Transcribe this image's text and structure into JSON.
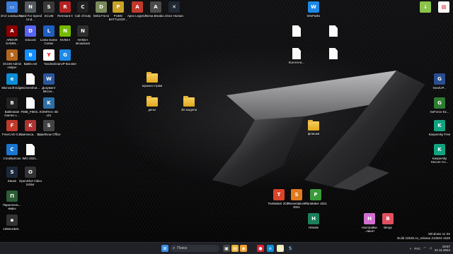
{
  "desktop": {
    "icons": [
      {
        "id": "this-pc",
        "label": "Этот компьютер",
        "kind": "app",
        "color": "#3b7dd8",
        "glyph": "▭"
      },
      {
        "id": "nfs",
        "label": "Need For Speed Und...",
        "kind": "app",
        "color": "#555a60",
        "glyph": "N"
      },
      {
        "id": "scum",
        "label": "SCUM",
        "kind": "app",
        "color": "#3a3a3a",
        "glyph": "S"
      },
      {
        "id": "remnant",
        "label": "Remnant II",
        "kind": "app",
        "color": "#b22222",
        "glyph": "R"
      },
      {
        "id": "cod",
        "label": "Call of Duty",
        "kind": "app",
        "color": "#222",
        "glyph": "C"
      },
      {
        "id": "delta",
        "label": "Delta Force",
        "kind": "app",
        "color": "#7a8a5a",
        "glyph": "D"
      },
      {
        "id": "pubg",
        "label": "PUBG BATTLEGR...",
        "kind": "app",
        "color": "#c9a227",
        "glyph": "P"
      },
      {
        "id": "apex",
        "label": "Apex Legends",
        "kind": "app",
        "color": "#c0392b",
        "glyph": "A"
      },
      {
        "id": "arena",
        "label": "Arena Breako...",
        "kind": "app",
        "color": "#4a4a4a",
        "glyph": "A"
      },
      {
        "id": "once-human",
        "label": "Once Human",
        "kind": "app",
        "color": "#202833",
        "glyph": "✕"
      },
      {
        "id": "ardor",
        "label": "ARDOR GAMIN...",
        "kind": "app",
        "color": "#8b0000",
        "glyph": "A"
      },
      {
        "id": "discord",
        "label": "Discord",
        "kind": "app",
        "color": "#5865f2",
        "glyph": "D"
      },
      {
        "id": "lesta",
        "label": "Lesta Game Center",
        "kind": "app",
        "color": "#1f5fbf",
        "glyph": "L"
      },
      {
        "id": "nvidia",
        "label": "NVIDIA",
        "kind": "app",
        "color": "#76b900",
        "glyph": "N"
      },
      {
        "id": "nvidia-broadcast",
        "label": "NVIDIA Broadcast",
        "kind": "app",
        "color": "#2e2e2e",
        "glyph": "N"
      },
      {
        "id": "scum-admin",
        "label": "SCUM Admin Helper",
        "kind": "app",
        "color": "#b5651d",
        "glyph": "S"
      },
      {
        "id": "battlenet",
        "label": "Battle.net",
        "kind": "app",
        "color": "#148eff",
        "glyph": "B"
      },
      {
        "id": "yandex",
        "label": "Yandex",
        "kind": "app",
        "color": "#ffffff",
        "glyph": "Y"
      },
      {
        "id": "gearup",
        "label": "GearUP Booster",
        "kind": "app",
        "color": "#1e88e5",
        "glyph": "G"
      },
      {
        "id": "edge",
        "label": "Microsoft Edge",
        "kind": "app",
        "color": "#0c8dd6",
        "glyph": "e"
      },
      {
        "id": "screenshot",
        "label": "Screenshot...",
        "kind": "doc"
      },
      {
        "id": "word-doc",
        "label": "Документ Micros...",
        "kind": "app",
        "color": "#2b579a",
        "glyph": "W"
      },
      {
        "id": "battlestate",
        "label": "Battlestate Games L...",
        "kind": "app",
        "color": "#222",
        "glyph": "B"
      },
      {
        "id": "f868",
        "label": "F868_F8G6...",
        "kind": "doc"
      },
      {
        "id": "kompas-3d",
        "label": "KOMПАС-3D v21",
        "kind": "app",
        "color": "#2f6fa5",
        "glyph": "K"
      },
      {
        "id": "freecad",
        "label": "FreeCAD 0.21",
        "kind": "app",
        "color": "#c0392b",
        "glyph": "F"
      },
      {
        "id": "kompas-graph",
        "label": "Компенса... тор",
        "kind": "app",
        "color": "#a33",
        "glyph": "K"
      },
      {
        "id": "smartnow",
        "label": "SmartNow Office",
        "kind": "app",
        "color": "#444",
        "glyph": "S"
      },
      {
        "id": "creality",
        "label": "CrealityScan",
        "kind": "app",
        "color": "#1976d2",
        "glyph": "C"
      },
      {
        "id": "img-2021",
        "label": "IMG-2021...",
        "kind": "doc"
      },
      {
        "id": "steam",
        "label": "Steam",
        "kind": "app",
        "color": "#1b2838",
        "glyph": "S"
      },
      {
        "id": "openshot",
        "label": "OpenShot Video Editor",
        "kind": "app",
        "color": "#333",
        "glyph": "O"
      },
      {
        "id": "parallels",
        "label": "Параллель... миры",
        "kind": "app",
        "color": "#2d5d34",
        "glyph": "П"
      },
      {
        "id": "file-1",
        "label": "1080x1920...",
        "kind": "app",
        "color": "#333",
        "glyph": "▪"
      },
      {
        "id": "folder-music",
        "label": "музыка стрим",
        "kind": "folder"
      },
      {
        "id": "folder-money",
        "label": "деньг",
        "kind": "folder"
      },
      {
        "id": "folder-3d",
        "label": "3D модели",
        "kind": "folder"
      },
      {
        "id": "folder-flash",
        "label": "флешки",
        "kind": "folder"
      },
      {
        "id": "word-top",
        "label": "WinPaths",
        "kind": "app",
        "color": "#1e88e5",
        "glyph": "W"
      },
      {
        "id": "doc-1",
        "label": "",
        "kind": "doc"
      },
      {
        "id": "doc-2",
        "label": "",
        "kind": "doc"
      },
      {
        "id": "doc-3",
        "label": "Контента...",
        "kind": "doc"
      },
      {
        "id": "doc-4",
        "label": "",
        "kind": "doc"
      },
      {
        "id": "text-maker",
        "label": "TextMaker 2021",
        "kind": "app",
        "color": "#d9442a",
        "glyph": "T"
      },
      {
        "id": "presentations",
        "label": "Presentations 2021",
        "kind": "app",
        "color": "#e07b1f",
        "glyph": "S"
      },
      {
        "id": "planmaker",
        "label": "PlanMaker 2021",
        "kind": "app",
        "color": "#3a9b3a",
        "glyph": "P"
      },
      {
        "id": "hisuite",
        "label": "HiSuite",
        "kind": "app",
        "color": "#1a7f5a",
        "glyph": "H"
      },
      {
        "id": "nastroyki",
        "label": "Настройки ..лиент",
        "kind": "app",
        "color": "#d06ed0",
        "glyph": "Н"
      },
      {
        "id": "bergs",
        "label": "Bergs",
        "kind": "app",
        "color": "#e05060",
        "glyph": "B"
      },
      {
        "id": "geforce",
        "label": "GeForce Ex...",
        "kind": "app",
        "color": "#2e7d32",
        "glyph": "G"
      },
      {
        "id": "gs",
        "label": "GearUP...",
        "kind": "app",
        "color": "#2a4d8f",
        "glyph": "G"
      },
      {
        "id": "kaspersky-free",
        "label": "Kaspersky Free",
        "kind": "app",
        "color": "#11a37f",
        "glyph": "K"
      },
      {
        "id": "kaspersky-sc",
        "label": "Kaspersky Secure Co...",
        "kind": "app",
        "color": "#11a37f",
        "glyph": "K"
      },
      {
        "id": "top-right-1",
        "label": "",
        "kind": "app",
        "color": "#8bc34a",
        "glyph": "↓"
      },
      {
        "id": "top-right-2",
        "label": "",
        "kind": "app",
        "color": "#fafafa",
        "glyph": "▤"
      }
    ],
    "sysinfo": {
      "line1": "Windows 11 Se",
      "line2": "Build 22635.ce_release.210604-1628"
    }
  },
  "taskbar": {
    "search_placeholder": "Поиск",
    "apps": [
      {
        "id": "start",
        "glyph": "⊞",
        "color": "#3a8ee6"
      },
      {
        "id": "tb-1",
        "glyph": "▣",
        "color": "#444"
      },
      {
        "id": "tb-2",
        "glyph": "▤",
        "color": "#e8b335"
      },
      {
        "id": "tb-3",
        "glyph": "◉",
        "color": "#f0a030"
      },
      {
        "id": "tb-4",
        "glyph": "●",
        "color": "#d23"
      },
      {
        "id": "tb-5",
        "glyph": "e",
        "color": "#0c8dd6"
      },
      {
        "id": "tb-6",
        "glyph": "◎",
        "color": "#eeb"
      },
      {
        "id": "tb-7",
        "glyph": "S",
        "color": "#1b2838"
      }
    ],
    "tray": {
      "lang": "РУС",
      "time": "19:57",
      "date": "22.11.2024"
    }
  }
}
